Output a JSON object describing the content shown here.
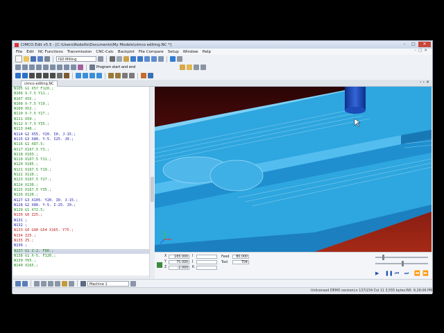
{
  "window": {
    "title": "CIMCO Edit v5.5 - [C:\\Users\\Rodolfo\\Documents\\My Models\\cimco editing.NC *]"
  },
  "menu": [
    "File",
    "Edit",
    "NC Functions",
    "Transmission",
    "CNC-Calc",
    "Backplot",
    "File Compare",
    "Setup",
    "Window",
    "Help"
  ],
  "toolbar": {
    "machine_type": "ISO Milling",
    "program_start": "Program start and end"
  },
  "tab": {
    "label": "cimco editing.NC"
  },
  "code": [
    {
      "t": "N105 G1 X57 F120.;",
      "c": "g"
    },
    {
      "t": "N106 X-7.5 Y11.;",
      "c": "g"
    },
    {
      "t": "N107 X55.;",
      "c": "g"
    },
    {
      "t": "N108 X-7.5 Y19.;",
      "c": "g"
    },
    {
      "t": "N109 X52.;",
      "c": "g"
    },
    {
      "t": "N110 X-7.5 Y27.;",
      "c": "g"
    },
    {
      "t": "N111 X50.;",
      "c": "g"
    },
    {
      "t": "N112 X-7.5 Y35.;",
      "c": "g"
    },
    {
      "t": "N113 X40.;",
      "c": "g"
    },
    {
      "t": "N114 G2 X55. Y20. I0. J-15.;",
      "c": "b"
    },
    {
      "t": "N115 G3 X80. Y-5. I25. J0.;",
      "c": "b"
    },
    {
      "t": "N116 G1 X87.5;",
      "c": "g"
    },
    {
      "t": "N117 X167.5 Y3.;",
      "c": "g"
    },
    {
      "t": "N118 X103.;",
      "c": "g"
    },
    {
      "t": "N119 X167.5 Y11.;",
      "c": "g"
    },
    {
      "t": "N120 X105.;",
      "c": "g"
    },
    {
      "t": "N121 X167.5 Y19.;",
      "c": "g"
    },
    {
      "t": "N122 X110.;",
      "c": "g"
    },
    {
      "t": "N123 X167.5 Y27.;",
      "c": "g"
    },
    {
      "t": "N124 X130.;",
      "c": "g"
    },
    {
      "t": "N125 X167.5 Y35.;",
      "c": "g"
    },
    {
      "t": "N126 X120.;",
      "c": "g"
    },
    {
      "t": "N127 G3 X105. Y20. I0. J-15.;",
      "c": "b"
    },
    {
      "t": "N128 G2 X80. Y-5. I-25. J0.;",
      "c": "b"
    },
    {
      "t": "N129 G1 X72.5;",
      "c": "g"
    },
    {
      "t": "N130 G0 Z25.;",
      "c": "r"
    },
    {
      "t": "N131 ;",
      "c": "b"
    },
    {
      "t": "N132 ;",
      "c": "b"
    },
    {
      "t": "N133 G0 G90 G54 X165. Y75.;",
      "c": "r"
    },
    {
      "t": "N134 Z25.;",
      "c": "r"
    },
    {
      "t": "N135 Z5.;",
      "c": "r"
    },
    {
      "t": "N136 ;",
      "c": "b"
    },
    {
      "t": "N137 G1 Z-2. F80.;",
      "c": "g hl"
    },
    {
      "t": "N138 G1 X-5. F120.;",
      "c": "g"
    },
    {
      "t": "N139 Y65.;",
      "c": "g"
    },
    {
      "t": "N140 X165.;",
      "c": "g"
    }
  ],
  "readout": {
    "x_label": "X",
    "x_value": "165.000",
    "y_label": "Y",
    "y_value": "75.000",
    "z_label": "Z",
    "z_value": "-2.000",
    "i_label": "I",
    "j_label": "J",
    "k_label": "K",
    "feed_label": "Feed",
    "feed_value": "80.000",
    "tool_label": "Tool",
    "tool_value": "T04"
  },
  "bottom": {
    "machine": "Machine 1"
  },
  "status": {
    "license": "Unlicensed DEMO version",
    "position": "Ln 137/234  Col 11  3,555 bytes",
    "mode": "INS",
    "time": "6:28:06 PM"
  },
  "colors": {
    "stock": "#2aa7df",
    "stock_dark": "#1c86c0",
    "tool": "#1b4fb0"
  }
}
